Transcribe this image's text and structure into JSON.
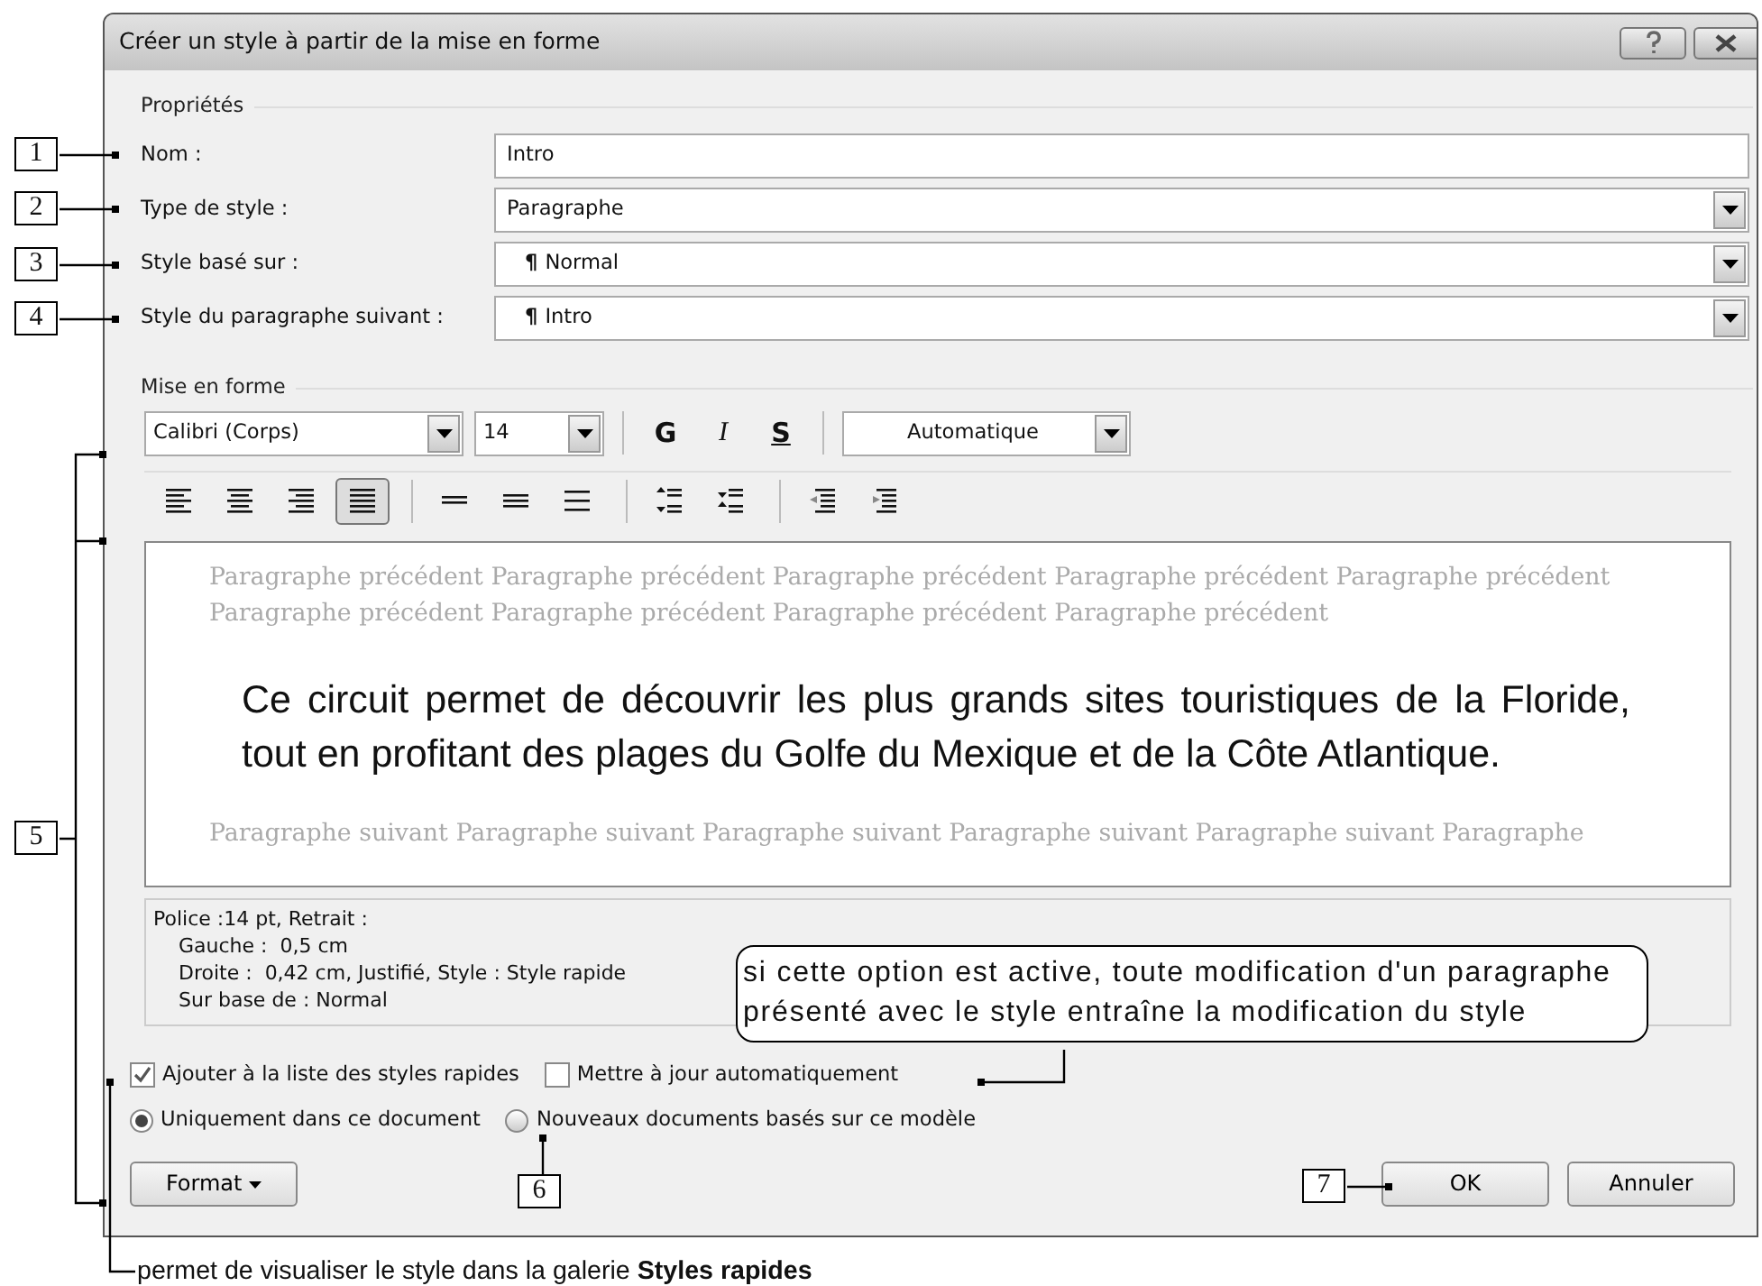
{
  "window": {
    "title": "Créer un style à partir de la mise en forme"
  },
  "properties": {
    "heading": "Propriétés",
    "fields": [
      {
        "label": "Nom :",
        "kind": "text",
        "value": "Intro"
      },
      {
        "label": "Type de style :",
        "kind": "select",
        "value": "Paragraphe"
      },
      {
        "label": "Style basé sur :",
        "kind": "select",
        "symbol": "¶",
        "value": "Normal"
      },
      {
        "label": "Style du paragraphe suivant :",
        "kind": "select",
        "symbol": "¶",
        "value": "Intro"
      }
    ]
  },
  "formatting": {
    "heading": "Mise en forme",
    "font": "Calibri (Corps)",
    "size": "14",
    "tint": "Automatique",
    "styles": [
      {
        "label": "G",
        "kind": "bold"
      },
      {
        "label": "I",
        "kind": "italic"
      },
      {
        "label": "S",
        "kind": "underline"
      }
    ],
    "paragraph_tools": [
      {
        "kind": "align-left",
        "selected": false
      },
      {
        "kind": "align-center",
        "selected": false
      },
      {
        "kind": "align-right",
        "selected": false
      },
      {
        "kind": "justify",
        "selected": true
      },
      {
        "kind": "spacing-single",
        "selected": false
      },
      {
        "kind": "spacing-one-half",
        "selected": false
      },
      {
        "kind": "spacing-double",
        "selected": false
      },
      {
        "kind": "space-increase",
        "selected": false
      },
      {
        "kind": "space-decrease",
        "selected": false
      },
      {
        "kind": "indent-decrease",
        "selected": false
      },
      {
        "kind": "indent-increase",
        "selected": false
      }
    ]
  },
  "preview": {
    "previous": "Paragraphe précédent Paragraphe précédent Paragraphe précédent Paragraphe précédent Paragraphe précédent Paragraphe précédent Paragraphe précédent Paragraphe précédent Paragraphe précédent",
    "sample": "Ce circuit permet de découvrir les plus grands sites touristiques de la Floride, tout en profitant des plages du Golfe du Mexique et de la Côte Atlantique.",
    "next": "Paragraphe suivant Paragraphe suivant Paragraphe suivant Paragraphe suivant Paragraphe suivant Paragraphe"
  },
  "description": {
    "first_line": "Police :14 pt, Retrait :",
    "details": [
      "Gauche :  0,5 cm",
      "Droite :  0,42 cm, Justifié, Style : Style rapide",
      "Sur base de : Normal"
    ]
  },
  "options": {
    "checkboxes": [
      {
        "label": "Ajouter à la liste des styles rapides",
        "checked": true
      },
      {
        "label": "Mettre à jour automatiquement",
        "checked": false
      }
    ],
    "scope": [
      {
        "label": "Uniquement dans ce document",
        "selected": true
      },
      {
        "label": "Nouveaux documents basés sur ce modèle",
        "selected": false
      }
    ]
  },
  "buttons": [
    {
      "label": "Format",
      "kind": "menu"
    },
    {
      "label": "OK",
      "kind": "push"
    },
    {
      "label": "Annuler",
      "kind": "push"
    }
  ],
  "annotations": {
    "markers": [
      "1",
      "2",
      "3",
      "4",
      "5",
      "6",
      "7"
    ],
    "notes": [
      {
        "kind": "bubble",
        "text": "si cette option est active, toute modification d'un paragraphe présenté avec le style entraîne la modification du style"
      },
      {
        "kind": "caption",
        "text": "permet de visualiser le style dans la galerie **Styles rapides**"
      }
    ]
  }
}
